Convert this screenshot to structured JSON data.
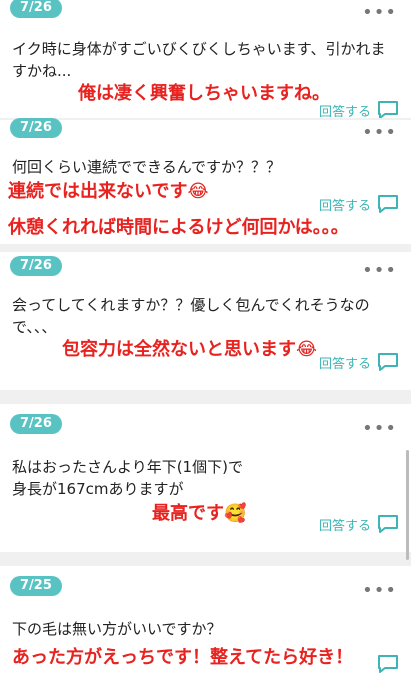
{
  "colors": {
    "accent": "#59c3c3",
    "answer": "#e8221f"
  },
  "reply_label": "回答する",
  "items": [
    {
      "date": "7/26",
      "question": "イク時に身体がすごいびくびくしちゃいます、引かれますかね...",
      "answer_lines": [
        "俺は凄く興奮しちゃいますね。"
      ]
    },
    {
      "date": "7/26",
      "question": "何回くらい連続でできるんですか？？？",
      "answer_lines": [
        "連続では出来ないです😂",
        "休憩くれれば時間によるけど何回かは。。。"
      ]
    },
    {
      "date": "7/26",
      "question": "会ってしてくれますか？？優しく包んでくれそうなので、、、",
      "answer_lines": [
        "包容力は全然ないと思います😂"
      ]
    },
    {
      "date": "7/26",
      "question": "私はおったさんより年下(1個下)で身長が167cmありますが",
      "answer_lines": [
        "最高です🥰"
      ]
    },
    {
      "date": "7/25",
      "question": "下の毛は無い方がいいですか？",
      "answer_lines": [
        "あった方がえっちです！整えてたら好き！"
      ]
    }
  ]
}
